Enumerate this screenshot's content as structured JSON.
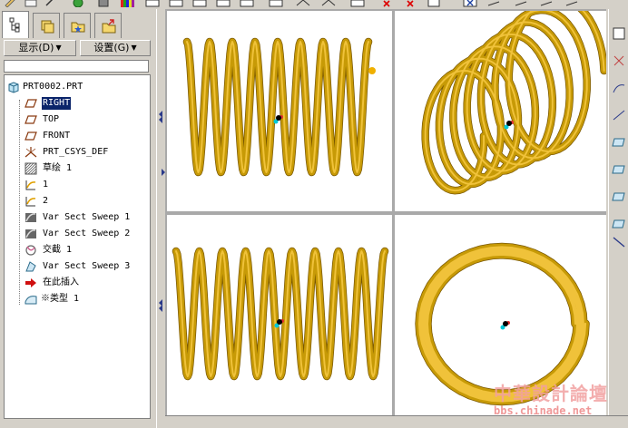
{
  "left_panel": {
    "menu": [
      {
        "label": "显示(D)",
        "arrow": "▼"
      },
      {
        "label": "设置(G)",
        "arrow": "▼"
      }
    ]
  },
  "model_tree": {
    "items": [
      {
        "label": "PRT0002.PRT",
        "icon": "part-icon"
      },
      {
        "label": "RIGHT",
        "icon": "datum-plane-icon",
        "selected": true
      },
      {
        "label": "TOP",
        "icon": "datum-plane-icon"
      },
      {
        "label": "FRONT",
        "icon": "datum-plane-icon"
      },
      {
        "label": "PRT_CSYS_DEF",
        "icon": "coordinate-system-icon"
      },
      {
        "label": "草绘 1",
        "icon": "sketch-icon"
      },
      {
        "label": "1",
        "icon": "datum-curve-icon"
      },
      {
        "label": "2",
        "icon": "datum-curve-icon"
      },
      {
        "label": "Var Sect Sweep 1",
        "icon": "sweep-icon"
      },
      {
        "label": "Var Sect Sweep 2",
        "icon": "sweep-icon"
      },
      {
        "label": "交截 1",
        "icon": "intersect-icon"
      },
      {
        "label": "Var Sect Sweep 3",
        "icon": "sweep-icon"
      },
      {
        "label": "在此插入",
        "icon": "insert-here-arrow-icon"
      },
      {
        "label": "※类型 1",
        "icon": "type-feature-icon"
      }
    ]
  },
  "watermark": {
    "title": "中華設計論壇",
    "url": "bbs.chinade.net"
  },
  "colors": {
    "spring": "#c79a06",
    "spring_highlight": "#f0c23a",
    "spring_shadow": "#7a5800",
    "selection": "#0a246a",
    "panel": "#d4d0c8"
  }
}
